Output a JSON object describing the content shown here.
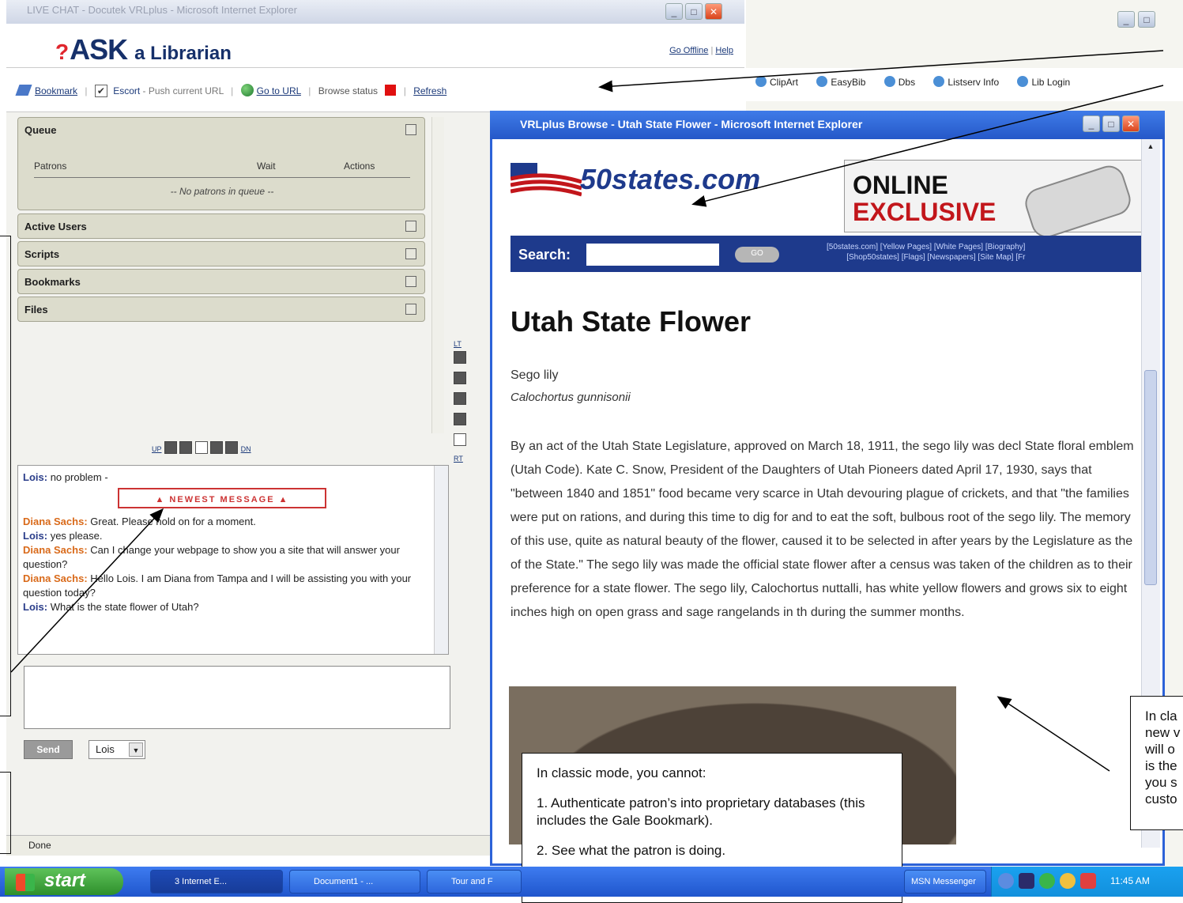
{
  "left_window": {
    "title": "LIVE CHAT - Docutek VRLplus - Microsoft Internet Explorer",
    "logo_text": "ASK",
    "logo_suffix": "a Librarian",
    "go_offline": "Go Offline",
    "help": "Help",
    "toolbar": {
      "bookmark": "Bookmark",
      "escort": "Escort",
      "push_url": "- Push current URL",
      "go_to_url": "Go to URL",
      "browse_status": "Browse status",
      "refresh": "Refresh"
    },
    "queue": {
      "title": "Queue",
      "col_patrons": "Patrons",
      "col_wait": "Wait",
      "col_actions": "Actions",
      "empty": "-- No patrons in queue --"
    },
    "panels": [
      "Active Users",
      "Scripts",
      "Bookmarks",
      "Files"
    ],
    "side_labels": {
      "top": "LT",
      "bottom": "RT",
      "up": "UP",
      "dn": "DN"
    },
    "chat": {
      "newest_banner": "▲ NEWEST MESSAGE ▲",
      "messages": [
        {
          "who": "Lois",
          "text": "no problem -"
        },
        {
          "who": "Diana Sachs",
          "text": "Great. Please hold on for a moment."
        },
        {
          "who": "Lois",
          "text": "yes please."
        },
        {
          "who": "Diana Sachs",
          "text": "Can I change your webpage to show you a site that will answer your question?"
        },
        {
          "who": "Diana Sachs",
          "text": "Hello Lois. I am Diana from Tampa and I will be assisting you with your question today?"
        },
        {
          "who": "Lois",
          "text": "What is the state flower of Utah?"
        }
      ]
    },
    "send": "Send",
    "user_select": "Lois",
    "status": "Done"
  },
  "right_window": {
    "links": [
      "ClipArt",
      "EasyBib",
      "Dbs",
      "Listserv Info",
      "Lib Login"
    ]
  },
  "popup": {
    "title": "VRLplus Browse - Utah State Flower - Microsoft Internet Explorer",
    "site_logo": "50states.com",
    "ad_line1": "ONLINE",
    "ad_line2": "EXCLUSIVE",
    "search_label": "Search:",
    "go": "GO",
    "site_links_1": "[50states.com] [Yellow Pages] [White Pages] [Biography]",
    "site_links_2": "[Shop50states] [Flags] [Newspapers] [Site Map] [Fr",
    "heading": "Utah State Flower",
    "common_name": "Sego lily",
    "latin_name": "Calochortus gunnisonii",
    "body": "By an act of the Utah State Legislature, approved on March 18, 1911, the sego lily was decl State floral emblem (Utah Code). Kate C. Snow, President of the Daughters of Utah Pioneers dated April 17, 1930, says that \"between 1840 and 1851\" food became very scarce in Utah devouring plague of crickets, and that \"the families were put on rations, and during this time to dig for and to eat the soft, bulbous root of the sego lily. The memory of this use, quite as natural beauty of the flower, caused it to be selected in after years by the Legislature as the of the State.\" The sego lily was made the official state flower after a census was taken of the children as to their preference for a state flower. The sego lily, Calochortus nuttalli, has white yellow flowers and grows six to eight inches high on open grass and sage rangelands in th during the summer months."
  },
  "callouts": {
    "main_1": "In classic mode, you cannot:",
    "main_2": "1.  Authenticate patron’s into proprietary databases (this includes the Gale Bookmark).",
    "main_3": "2.  See what the patron is doing.",
    "side": [
      "In cla",
      "new v",
      "will o",
      "is the",
      "you s",
      "custo"
    ]
  },
  "taskbar": {
    "start": "start",
    "tasks": [
      "3 Internet E...",
      "Document1 - ...",
      "Tour and F",
      "MSN Messenger"
    ],
    "clock": "11:45 AM"
  }
}
